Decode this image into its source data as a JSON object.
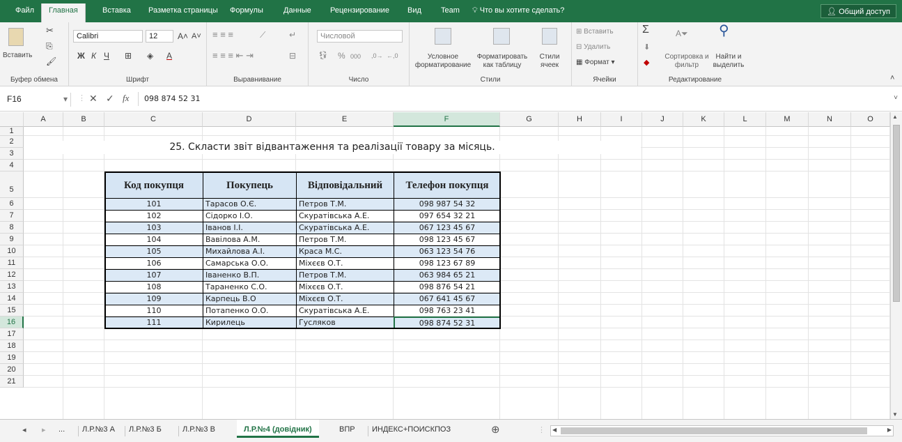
{
  "menu_tabs": [
    "Файл",
    "Главная",
    "Вставка",
    "Разметка страницы",
    "Формулы",
    "Данные",
    "Рецензирование",
    "Вид",
    "Team"
  ],
  "tell_me": "Что вы хотите сделать?",
  "share": "Общий доступ",
  "ribbon": {
    "clipboard": {
      "paste": "Вставить",
      "label": "Буфер обмена"
    },
    "font": {
      "name": "Calibri",
      "size": "12",
      "label": "Шрифт"
    },
    "alignment": {
      "label": "Выравнивание"
    },
    "number": {
      "format": "Числовой",
      "label": "Число"
    },
    "styles": {
      "conditional": "Условное форматирование",
      "as_table": "Форматировать как таблицу",
      "cell_styles": "Стили ячеек",
      "label": "Стили"
    },
    "cells": {
      "insert": "Вставить",
      "delete": "Удалить",
      "format": "Формат",
      "label": "Ячейки"
    },
    "editing": {
      "sort": "Сортировка и фильтр",
      "find": "Найти и выделить",
      "label": "Редактирование"
    }
  },
  "formula_bar": {
    "name_box": "F16",
    "content": "098 874 52 31"
  },
  "columns": [
    "A",
    "B",
    "C",
    "D",
    "E",
    "F",
    "G",
    "H",
    "I",
    "J",
    "K",
    "L",
    "M",
    "N",
    "O"
  ],
  "rows": [
    "1",
    "2",
    "3",
    "4",
    "5",
    "6",
    "7",
    "8",
    "9",
    "10",
    "11",
    "12",
    "13",
    "14",
    "15",
    "16",
    "17",
    "18",
    "19",
    "20",
    "21"
  ],
  "sheet_title": "25. Скласти звіт відвантаження та реалізації товару за місяць.",
  "table": {
    "headers": [
      "Код покупця",
      "Покупець",
      "Відповідальний",
      "Телефон покупця"
    ],
    "rows": [
      [
        "101",
        "Тарасов О.Є.",
        "Петров Т.М.",
        "098 987 54 32"
      ],
      [
        "102",
        "Сідорко І.О.",
        "Скуратівська А.Е.",
        "097 654 32 21"
      ],
      [
        "103",
        "Іванов І.І.",
        "Скуратівська А.Е.",
        "067 123 45 67"
      ],
      [
        "104",
        "Вавілова А.М.",
        "Петров Т.М.",
        "098 123 45 67"
      ],
      [
        "105",
        "Михайлова А.І.",
        "Краса М.С.",
        "063 123 54 76"
      ],
      [
        "106",
        "Самарська О.О.",
        "Міхєєв О.Т.",
        "098 123 67 89"
      ],
      [
        "107",
        "Іваненко В.П.",
        "Петров Т.М.",
        "063 984 65 21"
      ],
      [
        "108",
        "Тараненко С.О.",
        "Міхєєв О.Т.",
        "098 876 54 21"
      ],
      [
        "109",
        "Карпець В.О",
        "Міхєєв О.Т.",
        "067 641 45 67"
      ],
      [
        "110",
        "Потапенко О.О.",
        "Скуратівська А.Е.",
        "098 763 23 41"
      ],
      [
        "111",
        "Кирилець",
        "Гусляков",
        "098 874 52 31"
      ]
    ]
  },
  "sheet_tabs": [
    "...",
    "Л.Р.№3 А",
    "Л.Р.№3 Б",
    "Л.Р.№3 В",
    "Л.Р.№4  (довідник)",
    "ВПР",
    "ИНДЕКС+ПОИСКПОЗ"
  ],
  "active_sheet_index": 4,
  "colors": {
    "accent": "#217346",
    "stripe": "#dce9f6",
    "header_fill": "#d6e5f4"
  }
}
